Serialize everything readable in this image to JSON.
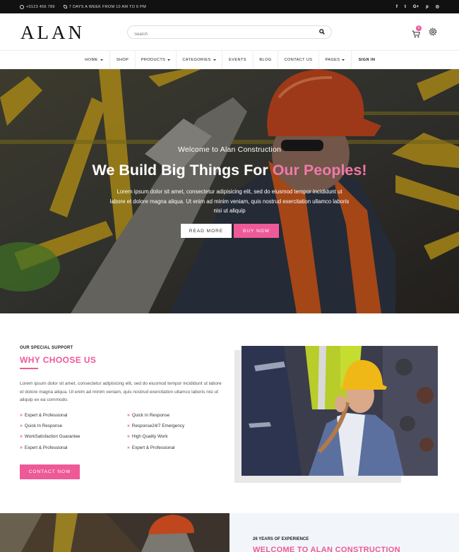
{
  "topbar": {
    "phone": "+0123 456 789",
    "hours": "7 DAYS A WEEK FROM 10 AM TO 6 PM",
    "social": [
      {
        "name": "facebook-icon",
        "glyph": "f"
      },
      {
        "name": "twitter-icon",
        "glyph": "t"
      },
      {
        "name": "google-plus-icon",
        "glyph": "G+"
      },
      {
        "name": "pinterest-icon",
        "glyph": "p"
      },
      {
        "name": "instagram-icon",
        "glyph": "◎"
      }
    ]
  },
  "header": {
    "logo": "ALAN",
    "search_placeholder": "Search",
    "cart_count": "0"
  },
  "nav": {
    "items": [
      {
        "label": "HOME",
        "dropdown": true
      },
      {
        "label": "SHOP",
        "dropdown": false
      },
      {
        "label": "PRODUCTS",
        "dropdown": true
      },
      {
        "label": "CATEGORIES",
        "dropdown": true
      },
      {
        "label": "EVENTS",
        "dropdown": false
      },
      {
        "label": "BLOG",
        "dropdown": false
      },
      {
        "label": "CONTACT US",
        "dropdown": false
      },
      {
        "label": "PAGES",
        "dropdown": true
      },
      {
        "label": "SIGN IN",
        "dropdown": false
      }
    ]
  },
  "hero": {
    "welcome": "Welcome to Alan Construction",
    "title_main": "We Build Big Things For",
    "title_accent": "Our Peoples!",
    "lead": "Lorem ipsum dolor sit amet, consectetur adipisicing elit, sed do eiusmod tempor incididunt ut labore et dolore magna aliqua. Ut enim ad minim veniam, quis nostrud exercitation ullamco laboris nisi ut aliquip",
    "read_more": "READ MORE",
    "buy_now": "BUY NOW"
  },
  "why": {
    "eyebrow": "OUR SPECIAL SUPPORT",
    "title": "WHY CHOOSE US",
    "paragraph": "Lorem ipsum dolor sit amet, consectetur adipisicing elit, sed do eiusmod tempor incididunt ut labore et dolore magna aliqua. Ut enim ad minim veniam, quis nostrud exercitation ullamco laboris nisi ut aliquip ex ea commodo.",
    "features_left": [
      "Expert & Professional",
      "Quick In Response",
      "WorkSatisfaction Guarantee",
      "Expert & Professional"
    ],
    "features_right": [
      "Quick In Response",
      "Response24/7 Emergency",
      "High Quality Work",
      "Expert & Professional"
    ],
    "contact_button": "CONTACT NOW"
  },
  "bottom": {
    "years": "26 YEARS OF EXPERIENCE",
    "heading": "WELCOME TO ALAN CONSTRUCTION"
  },
  "colors": {
    "accent": "#ee5a98",
    "topbar": "#111111"
  }
}
